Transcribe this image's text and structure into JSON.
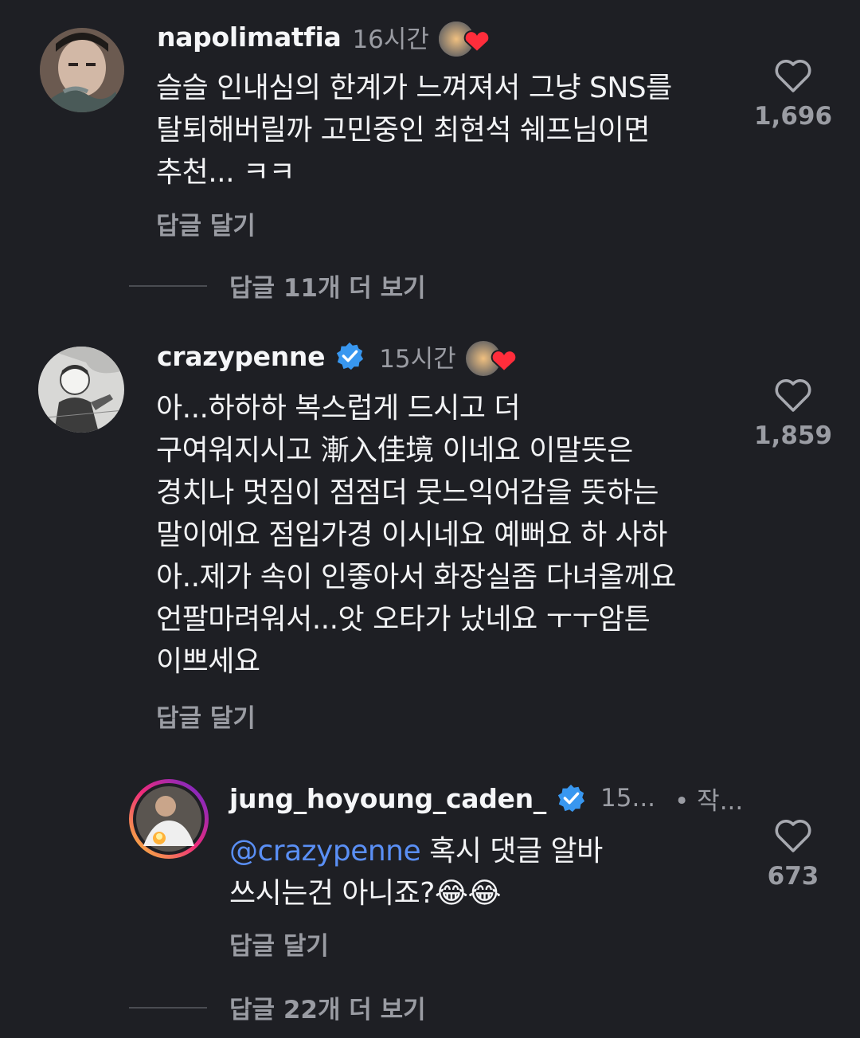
{
  "comments": [
    {
      "username": "napolimatfia",
      "time": "16시간",
      "text": "슬슬 인내심의 한계가 느껴져서 그냥 SNS를\n탈퇴해버릴까 고민중인 최현석 쉐프님이면\n추천... ㅋㅋ",
      "reply_label": "답글 달기",
      "likes": "1,696",
      "more_replies": "답글 11개 더 보기",
      "avatar_icon": "person-avatar-tattoo"
    },
    {
      "username": "crazypenne",
      "verified": true,
      "time": "15시간",
      "text": "아...하하하 복스럽게 드시고 더\n구여워지시고 漸入佳境 이네요 이말뜻은\n경치나 멋짐이 점점더 뭇느익어감을 뜻하는\n말이에요 점입가경 이시네요 예뻐요 하 사하\n아..제가 속이 인좋아서 화장실좀 다녀올께요\n언팔마려워서...앗 오타가 났네요 ㅜㅜ암튼\n이쁘세요",
      "reply_label": "답글 달기",
      "likes": "1,859",
      "avatar_icon": "sketch-avatar"
    },
    {
      "username": "jung_hoyoung_caden_",
      "verified": true,
      "time": "15...",
      "author_tag": "• 작...",
      "mention": "@crazypenne",
      "text_after_mention": " 혹시 댓글 알바\n쓰시는건 아니죠?😂😂",
      "reply_label": "답글 달기",
      "likes": "673",
      "more_replies": "답글 22개 더 보기",
      "avatar_icon": "chef-avatar-story-ring"
    }
  ],
  "colors": {
    "background": "#1e1f24",
    "text": "#f2f3f5",
    "muted": "#9a9ca3",
    "verified_blue": "#3897f0",
    "heart_red": "#ff2d3b",
    "mention_blue": "#5a8ff5"
  },
  "icons": {
    "like": "heart-outline-icon",
    "verified": "verified-badge-icon",
    "creator_liked": "creator-liked-heart-icon"
  }
}
